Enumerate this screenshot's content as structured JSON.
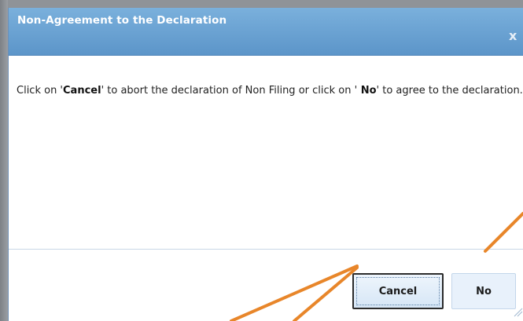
{
  "dialog": {
    "title": "Non-Agreement to the Declaration",
    "close_glyph": "x",
    "message": {
      "part1": "Click on '",
      "cancel_word": "Cancel",
      "part2": "' to abort the declaration of Non Filing or click on '",
      "no_word": " No",
      "part3": "' to agree to the declaration."
    },
    "buttons": {
      "cancel_label": "Cancel",
      "no_label": "No"
    }
  },
  "colors": {
    "title_bar": "#5c95c9",
    "annotation_lines": "#e8862a"
  },
  "icons": {
    "close": "close-icon",
    "resize": "resize-grip-icon"
  }
}
